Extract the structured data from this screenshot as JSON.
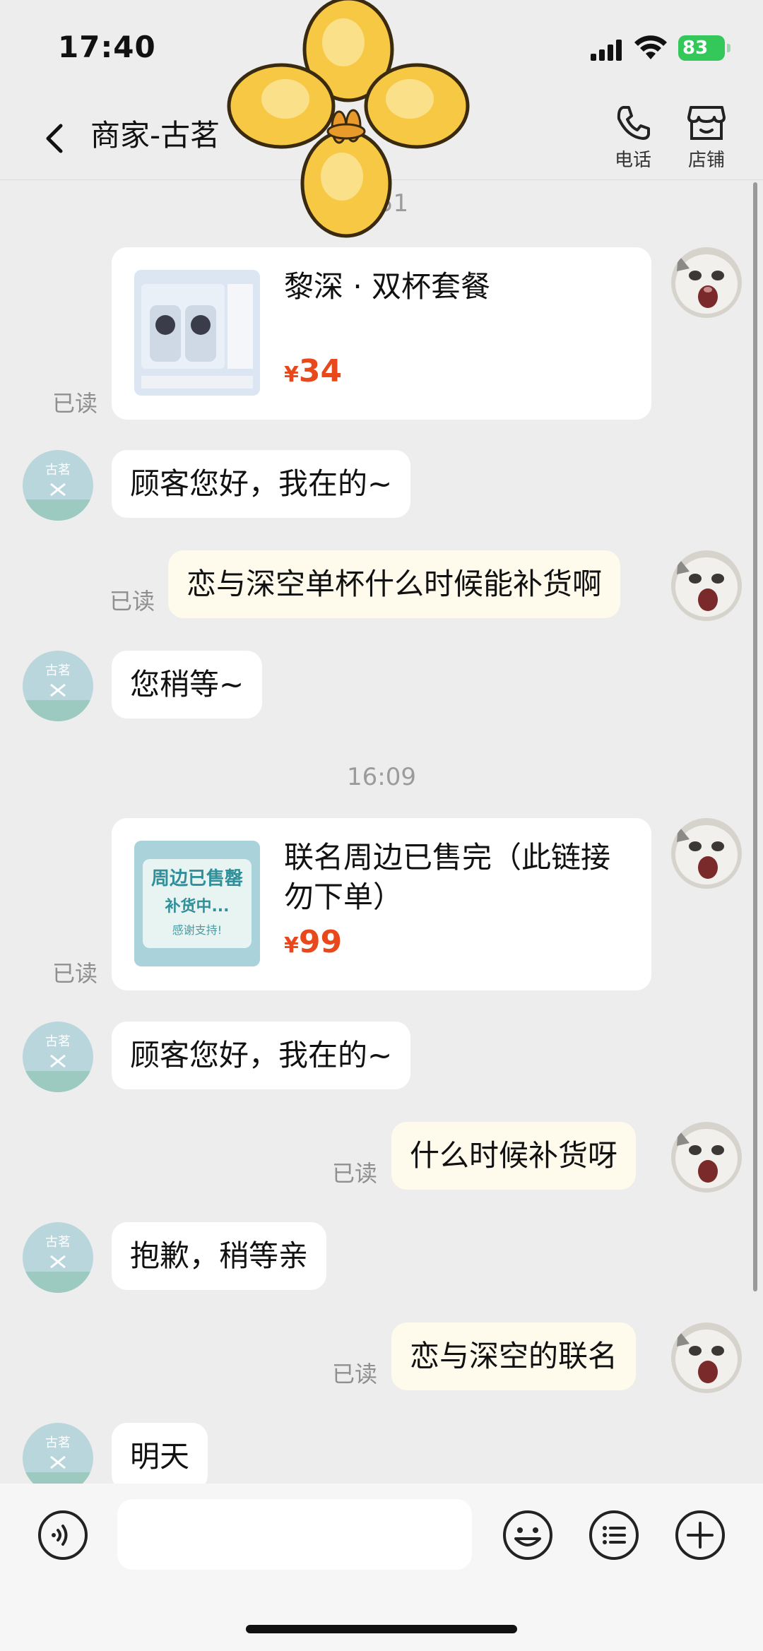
{
  "status_bar": {
    "time": "17:40",
    "battery": "83"
  },
  "header": {
    "title": "商家-古茗",
    "phone_label": "电话",
    "shop_label": "店铺"
  },
  "chat": {
    "time_first": "3:51",
    "time_second": "16:09",
    "read_label": "已读",
    "product_card_1": {
      "title": "黎深 · 双杯套餐",
      "currency": "¥",
      "price": "34"
    },
    "msg_greeting_1": "顾客您好，我在的~",
    "msg_q_restock_cup": "恋与深空单杯什么时候能补货啊",
    "msg_wait": "您稍等~",
    "product_card_2": {
      "title": "联名周边已售完（此链接勿下单）",
      "currency": "¥",
      "price": "99",
      "image_text_1": "周边已售罄",
      "image_text_2": "补货中...",
      "image_text_3": "感谢支持!"
    },
    "msg_greeting_2": "顾客您好，我在的~",
    "msg_q_when_restock": "什么时候补货呀",
    "msg_sorry": "抱歉，稍等亲",
    "msg_collab": "恋与深空的联名",
    "msg_tomorrow": "明天",
    "merchant_avatar_text": "古茗"
  },
  "colors": {
    "price": "#e8481c",
    "outgoing_bubble": "#fefbec",
    "battery": "#34c759"
  }
}
